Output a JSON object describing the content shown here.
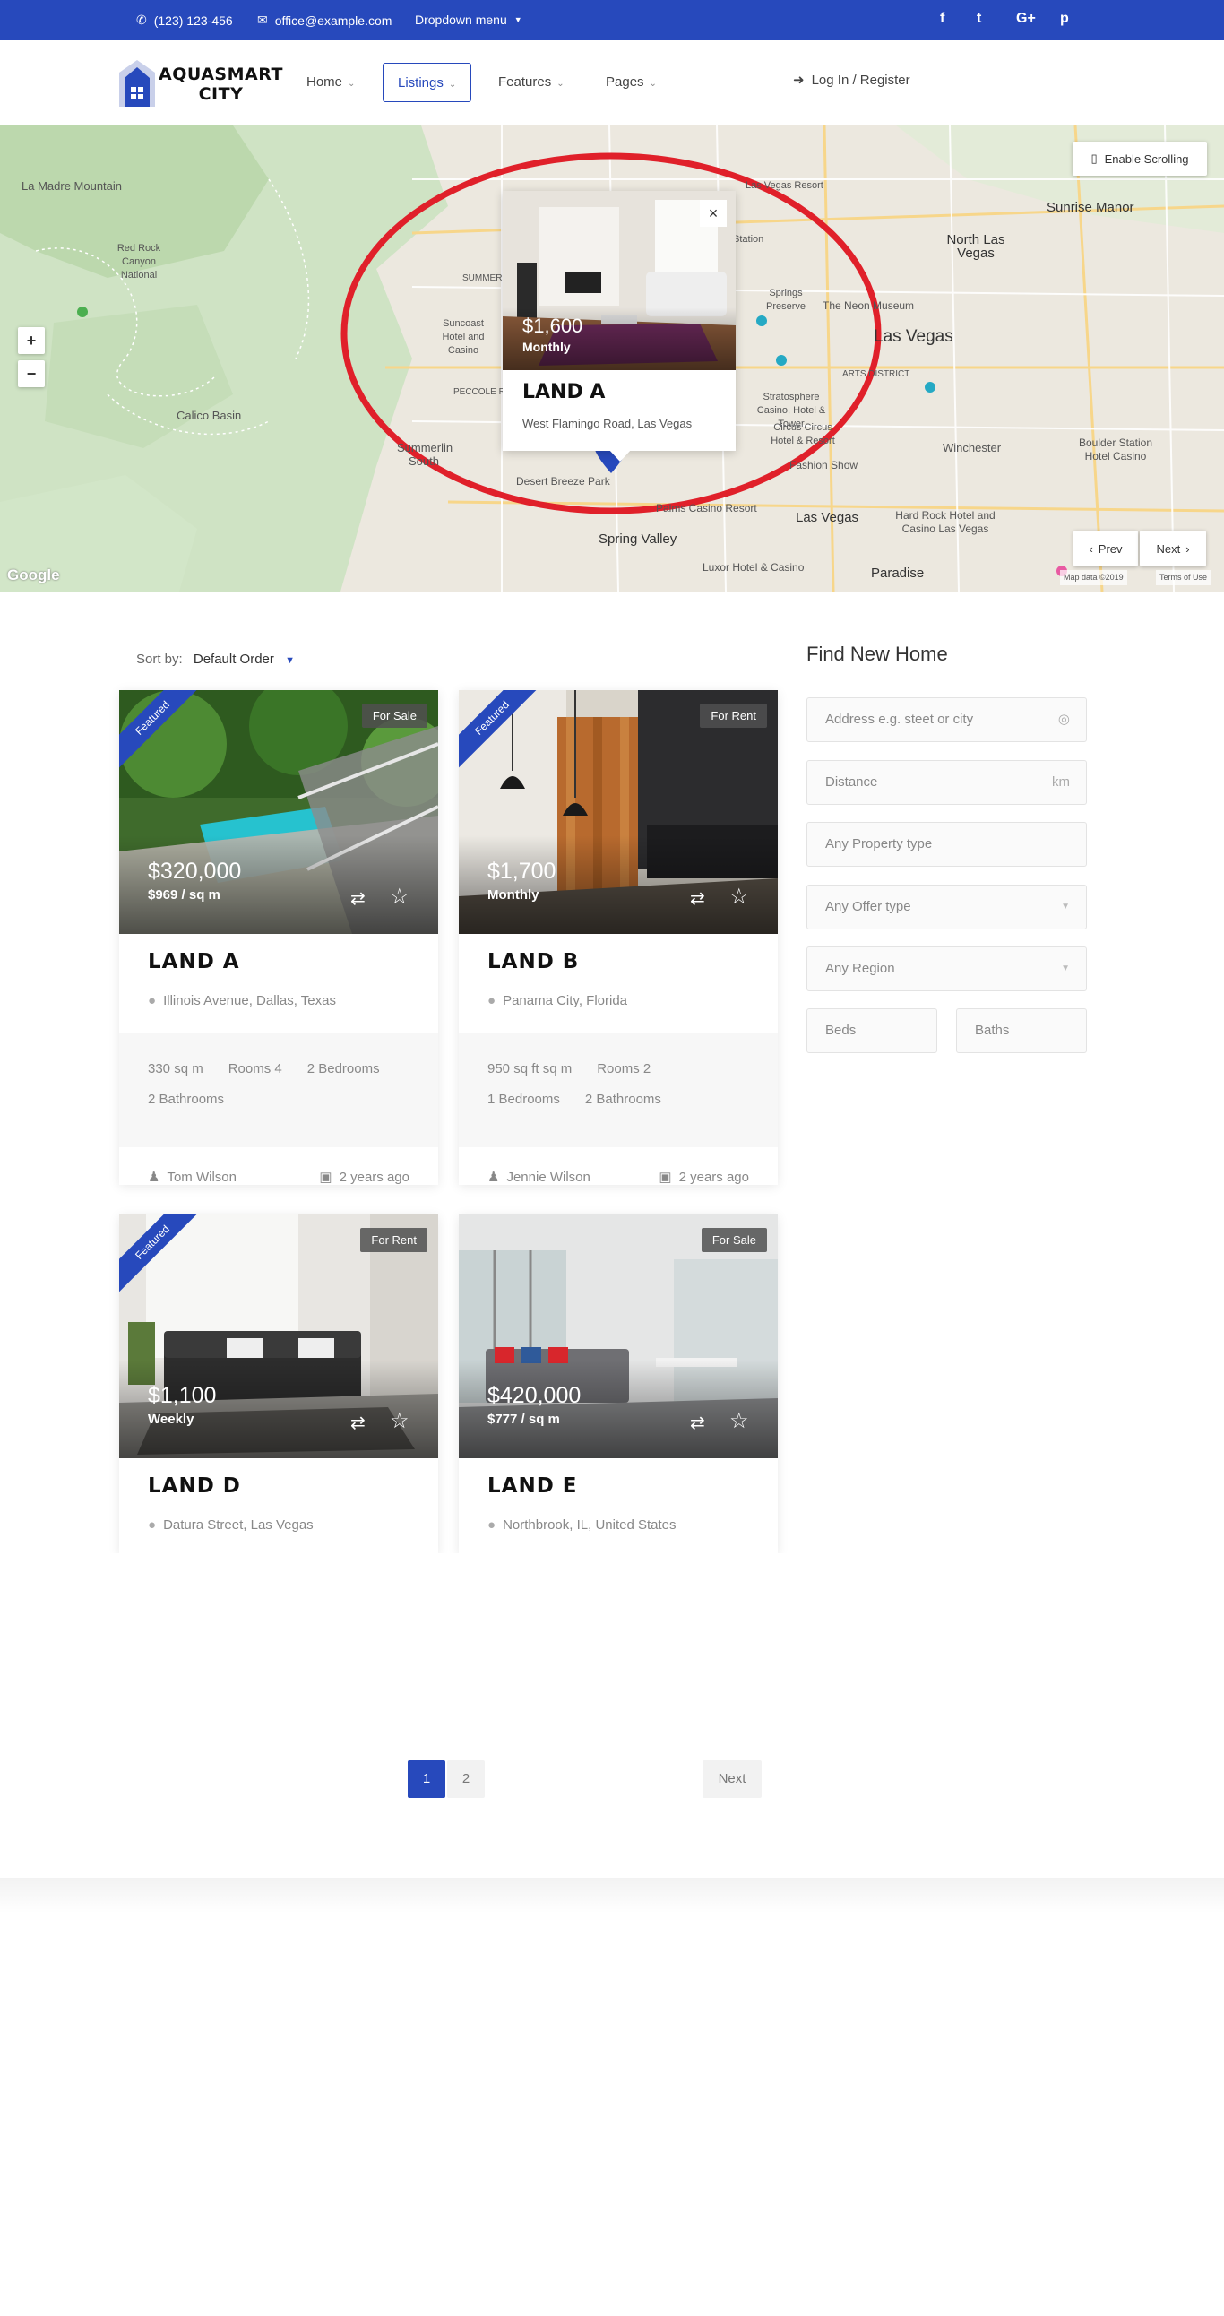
{
  "topbar": {
    "phone": "(123) 123-456",
    "email": "office@example.com",
    "dropdown": "Dropdown menu",
    "social": [
      "f",
      "t",
      "G+",
      "p"
    ]
  },
  "header": {
    "logo_line1": "AQUASMART",
    "logo_line2": "CITY",
    "nav": [
      "Home",
      "Listings",
      "Features",
      "Pages"
    ],
    "login": "Log In / Register"
  },
  "map": {
    "enable_scrolling": "Enable Scrolling",
    "zoom_in": "+",
    "zoom_out": "−",
    "prev": "Prev",
    "next": "Next",
    "attribution_google": "Google",
    "map_data": "Map data ©2019",
    "terms": "Terms of Use",
    "labels": [
      "La Madre Mountain",
      "Red Rock Canyon National",
      "Calico Basin",
      "Summerlin South",
      "Sunrise Manor",
      "North Las Vegas",
      "Las Vegas",
      "Winchester",
      "Boulder Station Hotel Casino",
      "Hard Rock Hotel and Casino Las Vegas",
      "Spring Valley",
      "Paradise",
      "Luxor Hotel & Casino",
      "Desert Breeze Park",
      "Stratosphere Casino, Hotel & Tower",
      "Circus Circus Hotel & Resort",
      "The Neon Museum",
      "Fashion Show",
      "Palms Casino Resort",
      "Las Vegas",
      "Suncoast Hotel and Casino",
      "Springs Preserve",
      "SUMMERLIN",
      "PECCOLE RANCH",
      "ARTS DISTRICT",
      "Las Vegas Resort",
      "Station"
    ],
    "popup": {
      "close": "×",
      "price": "$1,600",
      "period": "Monthly",
      "title": "LAND A",
      "address": "West Flamingo Road, Las Vegas"
    }
  },
  "listing": {
    "sort_label": "Sort by:",
    "sort_value": "Default Order",
    "cards": [
      {
        "ribbon": "Featured",
        "status": "For Sale",
        "price": "$320,000",
        "period": "$969 / sq m",
        "title": "LAND A",
        "address": "Illinois Avenue, Dallas, Texas",
        "specs": [
          "330 sq m",
          "Rooms 4",
          "2 Bedrooms",
          "2 Bathrooms"
        ],
        "agent": "Tom Wilson",
        "date": "2 years ago"
      },
      {
        "ribbon": "Featured",
        "status": "For Rent",
        "price": "$1,700",
        "period": "Monthly",
        "title": "LAND B",
        "address": "Panama City, Florida",
        "specs": [
          "950 sq ft sq m",
          "Rooms 2",
          "1 Bedrooms",
          "2 Bathrooms"
        ],
        "agent": "Jennie Wilson",
        "date": "2 years ago"
      },
      {
        "ribbon": "Featured",
        "status": "For Rent",
        "price": "$1,100",
        "period": "Weekly",
        "title": "LAND D",
        "address": "Datura Street, Las Vegas"
      },
      {
        "status": "For Sale",
        "price": "$420,000",
        "period": "$777 / sq m",
        "title": "LAND E",
        "address": "Northbrook, IL, United States"
      }
    ]
  },
  "search": {
    "title": "Find New Home",
    "address_placeholder": "Address e.g. steet or city",
    "distance_placeholder": "Distance",
    "distance_unit": "km",
    "property_type": "Any Property type",
    "offer_type": "Any Offer type",
    "region": "Any Region",
    "beds": "Beds",
    "baths": "Baths"
  },
  "pagination": {
    "pages": [
      "1",
      "2"
    ],
    "next": "Next"
  },
  "colors": {
    "accent": "#2749bc",
    "map_circle": "#e0202a"
  }
}
